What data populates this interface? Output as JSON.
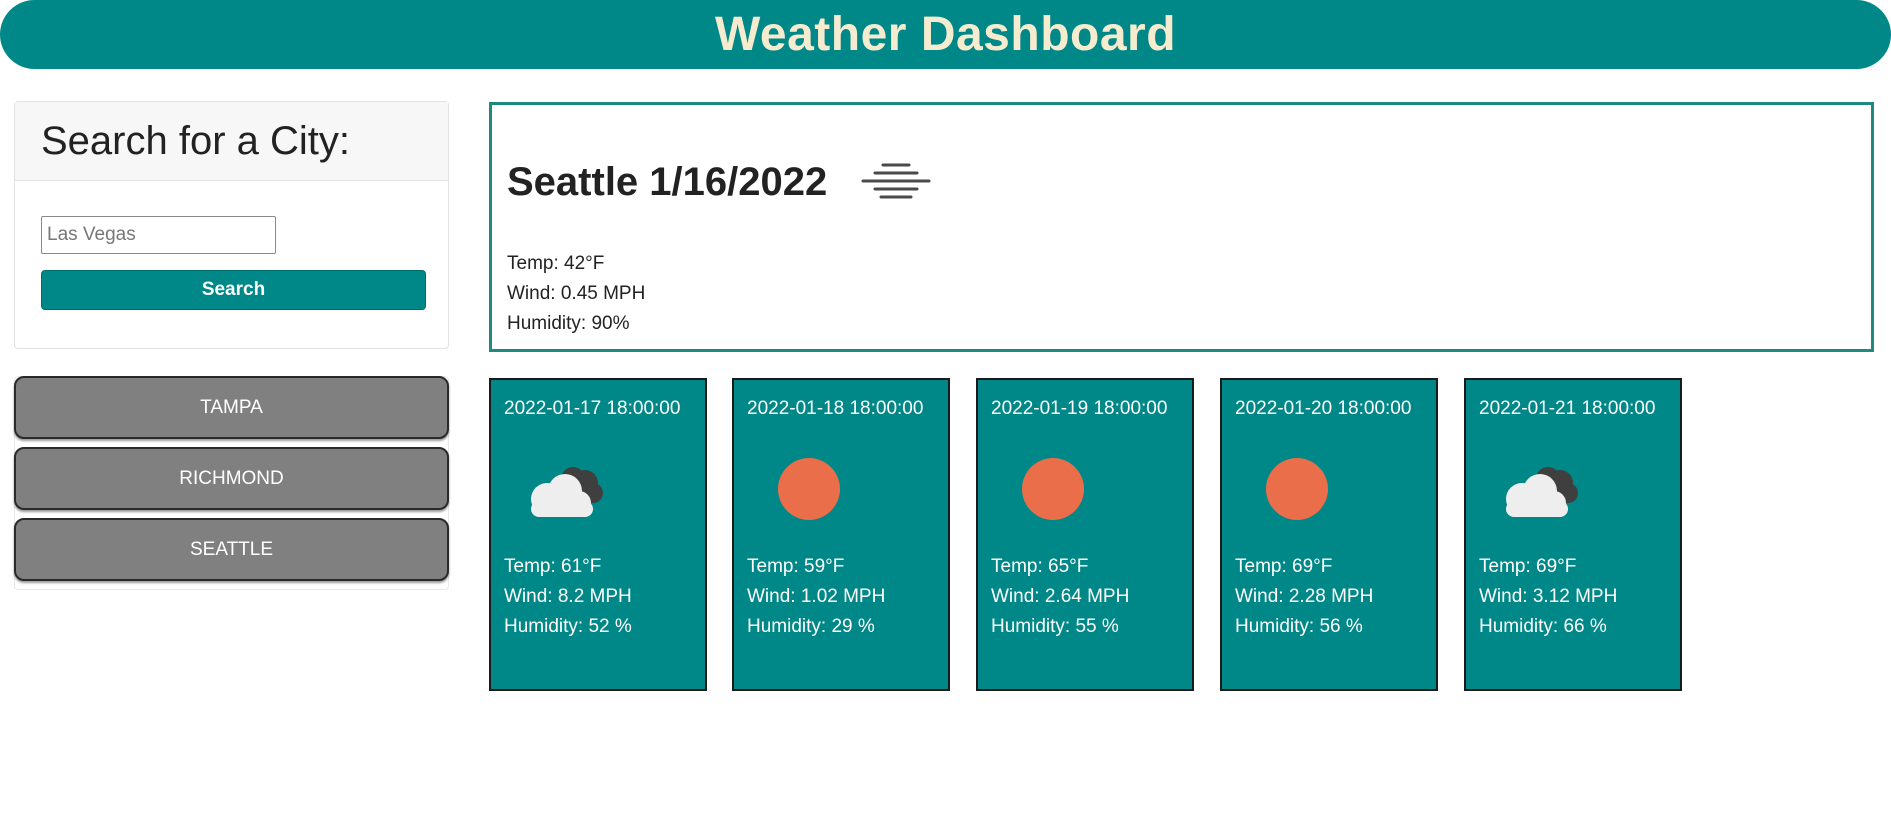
{
  "header": {
    "title": "Weather Dashboard"
  },
  "search": {
    "heading": "Search for a City:",
    "input_value": "",
    "input_placeholder": "Las Vegas",
    "button_label": "Search"
  },
  "history": [
    {
      "label": "TAMPA"
    },
    {
      "label": "RICHMOND"
    },
    {
      "label": "SEATTLE"
    }
  ],
  "current": {
    "title": "Seattle 1/16/2022",
    "icon": "fog-icon",
    "temp": "Temp: 42°F",
    "wind": "Wind: 0.45 MPH",
    "humidity": "Humidity: 90%"
  },
  "forecast": [
    {
      "date": "2022-01-17 18:00:00",
      "icon": "cloudy-icon",
      "temp": "Temp: 61°F",
      "wind": "Wind: 8.2 MPH",
      "humidity": "Humidity: 52 %"
    },
    {
      "date": "2022-01-18 18:00:00",
      "icon": "sun-icon",
      "temp": "Temp: 59°F",
      "wind": "Wind: 1.02 MPH",
      "humidity": "Humidity: 29 %"
    },
    {
      "date": "2022-01-19 18:00:00",
      "icon": "sun-icon",
      "temp": "Temp: 65°F",
      "wind": "Wind: 2.64 MPH",
      "humidity": "Humidity: 55 %"
    },
    {
      "date": "2022-01-20 18:00:00",
      "icon": "sun-icon",
      "temp": "Temp: 69°F",
      "wind": "Wind: 2.28 MPH",
      "humidity": "Humidity: 56 %"
    },
    {
      "date": "2022-01-21 18:00:00",
      "icon": "cloudy-icon",
      "temp": "Temp: 69°F",
      "wind": "Wind: 3.12 MPH",
      "humidity": "Humidity: 66 %"
    }
  ],
  "colors": {
    "accent": "#008787",
    "header_text": "#f5ecd0",
    "history_button": "#808080",
    "sun": "#eb6e4b"
  }
}
